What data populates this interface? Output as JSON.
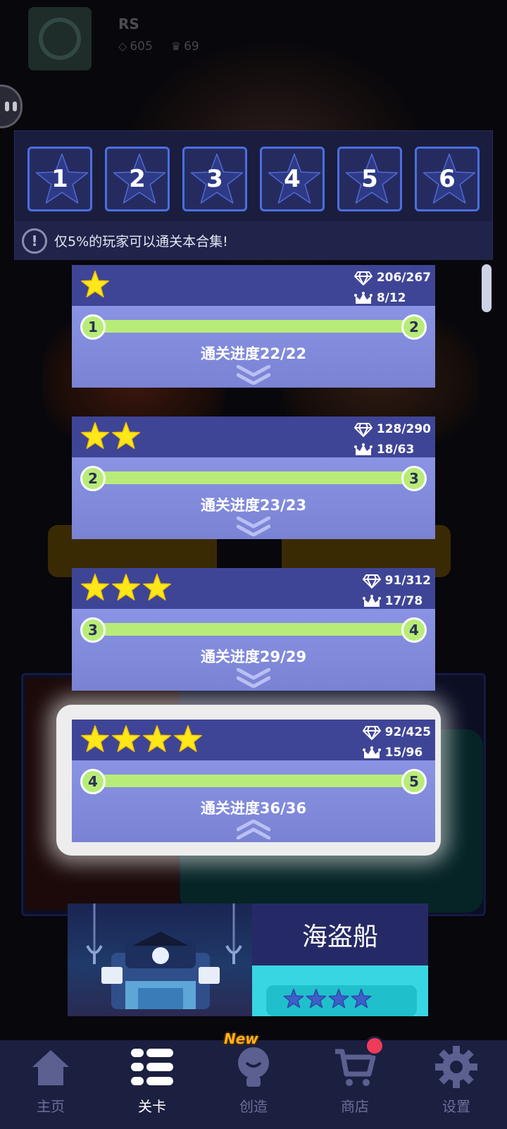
{
  "profile": {
    "name": "RS",
    "gems": "605",
    "crowns": "69"
  },
  "level_tiles": [
    "1",
    "2",
    "3",
    "4",
    "5",
    "6"
  ],
  "notice": "仅5%的玩家可以通关本合集!",
  "cards": [
    {
      "stars": 1,
      "gems": "206/267",
      "crowns": "8/12",
      "from": "1",
      "to": "2",
      "progress": "通关进度22/22",
      "chevron": "down",
      "progress_fraction": 1.0
    },
    {
      "stars": 2,
      "gems": "128/290",
      "crowns": "18/63",
      "from": "2",
      "to": "3",
      "progress": "通关进度23/23",
      "chevron": "down",
      "progress_fraction": 1.0
    },
    {
      "stars": 3,
      "gems": "91/312",
      "crowns": "17/78",
      "from": "3",
      "to": "4",
      "progress": "通关进度29/29",
      "chevron": "down",
      "progress_fraction": 1.0
    },
    {
      "stars": 4,
      "gems": "92/425",
      "crowns": "15/96",
      "from": "4",
      "to": "5",
      "progress": "通关进度36/36",
      "chevron": "up",
      "progress_fraction": 1.0,
      "selected": true
    }
  ],
  "pirate": {
    "title": "海盗船",
    "stars": 4
  },
  "nav": [
    {
      "label": "主页",
      "icon": "home-icon"
    },
    {
      "label": "关卡",
      "icon": "list-icon",
      "active": true
    },
    {
      "label": "创造",
      "icon": "lightbulb-icon",
      "badge": "New"
    },
    {
      "label": "商店",
      "icon": "cart-icon",
      "dot": true
    },
    {
      "label": "设置",
      "icon": "gear-icon"
    }
  ],
  "colors": {
    "card_header": "#3f4596",
    "card_body": "#8a94e3",
    "progress_green": "#b8ec78",
    "star_yellow": "#ffe81a",
    "tile_border": "#4a6fe0",
    "nav_bg": "#1b1f40"
  }
}
